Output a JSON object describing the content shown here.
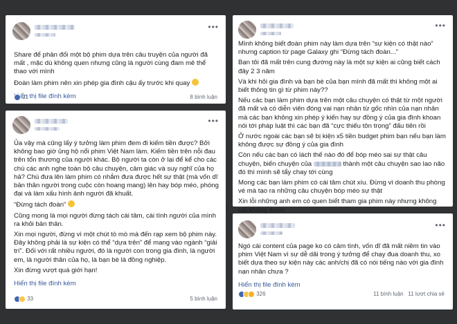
{
  "more_icon": "ellipsis-icon",
  "post1": {
    "paragraphs": [
      "Share để phản đối một bộ phim dựa trên câu truyện của người đã mất , mặc dù không quen nhưng cũng là người cùng đam mê thể thao với mình",
      "Đoàn làm phim nên xin phép gia đình cậu ấy trước khi quay"
    ],
    "see_attachment": "Hiển thị file đính kèm",
    "reaction_count": "21",
    "comments": "8 bình luận"
  },
  "post2": {
    "paragraphs": [
      "Ủa vậy mà cũng lấy ý tưởng làm phim đem đi kiếm tiền được? Bởi không bao giờ ủng hộ nổi phim Việt Nam làm. Kiếm tiền trên nỗi đau trên tổn thương của người khác. Bộ người ta còn ở lại để kể cho các chú các anh nghe toàn bộ câu chuyện, cảm giác và suy nghĩ của họ hả? Chú đưa lên làm phim có nhắm đưa được hết sự thật (mà vốn dĩ bản thân người trong cuộc còn hoang mang) lên hay bóp méo, phóng đại và làm xấu hình ảnh người đã khuất.",
      "“Đừng tách đoàn”",
      "Cũng mong là mọi người đừng tách cái tâm, cái tình người của mình ra khỏi bản thân.",
      "Xin mọi người, đừng vì một chút tò mò mà đến rạp xem bộ phim này. Đây không phải là sự kiện có thể “dựa trên” để mang vào ngành “giải trí”. Đối với rất nhiều người, đó là người con trong gia đình, là người em, là người thân của họ, là bạn bè là đồng nghiệp.",
      "Xin đừng vượt quá giới hạn!"
    ],
    "see_attachment": "Hiển thị file đính kèm",
    "reaction_count": "33",
    "comments": "5 bình luận"
  },
  "post3": {
    "paragraphs": [
      "Mình không biết đoàn phim này làm dựa trên “sự kiện có thật nào” nhưng caption từ page Galaxy ghi “Đừng tách đoàn...”",
      "Bạn tôi đã mất trên cung đường này là một sự kiện ai cũng biết cách đây 2 3 năm",
      "Và khi hỏi gia đình và bạn bè của bạn mình đã mất thì không một ai biết thông tin gì từ phim này??",
      "Nếu các bạn làm phim dựa trên một câu chuyện có thật từ một người đã mất và có diễn viên đóng vai nạn nhân từ gốc nhìn của nạn nhân mà các bạn không xin phép ý kiến hay sự đồng ý của gia đình khoan nói tới pháp luật thì các bạn đã “cực thiếu tôn trọng” đấu tiên rồi",
      "Ở nước ngoài các bạn sẽ bị kiện x5 tiền budget phim bạn nếu bạn làm không được sự đồng ý của gia đình",
      "Còn nếu các bạn có lách thế nào đó để bóp méo sai sự thật câu chuyện, biến chuyện của",
      "thành một câu chuyện sao lao não đó thì mình sẽ tẩy chay tới cùng",
      "Mong các bạn làm phim có cái tâm chút xíu. Đừng vì doanh thu phòng vé mà tạo ra những câu chuyện bóp méo sự thật",
      "Xin lỗi những anh em có quen biết tham gia phim này nhưng không nói không được."
    ]
  },
  "post4": {
    "paragraphs": [
      "Ngó cái content của page ko có cảm tình, vốn dĩ đã mất niềm tin vào phim Việt Nam vì sự dễ dãi trong ý tưởng để chạy đua doanh thu, xo biết dựa theo sự kiện này các anh/chị đã có nói tiếng nào với gia đình nạn nhân chưa ?"
    ],
    "see_attachment": "Hiển thị file đính kèm",
    "reaction_count": "326",
    "comments": "11 bình luận",
    "shares": "11 lượt chia sẻ"
  }
}
